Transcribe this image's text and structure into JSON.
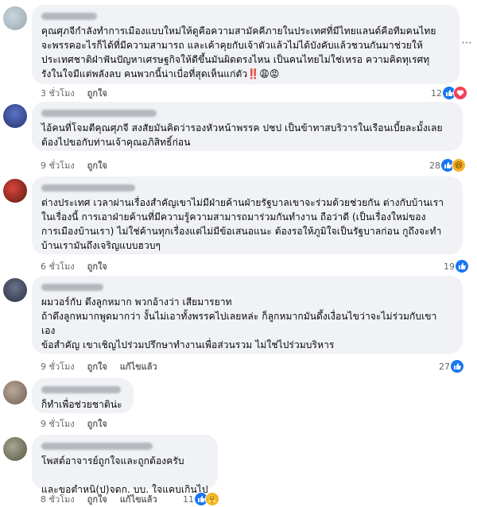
{
  "actions": {
    "like": "ถูกใจ",
    "reply": "",
    "edited": "แก้ไขแล้ว"
  },
  "comments": [
    {
      "text": "คุณศุภจีกำลังทำการเมืองแบบใหม่ให้ดูคือความสามัคคีภายในประเทศที่มีไทยแลนด์คือทีมคนไทย\nจะพรรคอะไรก็ได้ที่มีความสามารถ และเค้าคุยกับเจ้าตัวแล้วไม่ได้บังคับแล้วชวนกันมาช่วยให้\nประเทศชาติฝ่าฟันปัญหาเศรษฐกิจให้ดีขึ้นมันผิดตรงไหน เป็นคนไทยไม่ใช่เหรอ ความคิดทุเรศทุ\nรังในใจมีแต่พลังลบ คนพวกนี้น่าเบื่อที่สุดเห็นแก่ตัว‼️😩😡",
      "time": "3 ชั่วโมง",
      "reaction_count": "12",
      "reactions": [
        "like",
        "love"
      ]
    },
    {
      "text": "ไอ้คนที่โจมตีคุณศุภจี สงสัยมันคิดว่ารองหัวหน้าพรรค ปชป เป็นข้าทาสบริวารในเรือนเบี้ยละมั้งเลย\nต้องไปขอกับท่านเจ้าคุณอภิสิทธิ์ก่อน",
      "time": "9 ชั่วโมง",
      "reaction_count": "28",
      "reactions": [
        "like",
        "haha"
      ]
    },
    {
      "text": "ต่างประเทศ เวลาผ่านเรื่องสำคัญเขาไม่มีฝ่ายค้านฝ่ายรัฐบาลเขาจะร่วมด้วยช่วยกัน ต่างกับบ้านเรา\nในเรื่องนี้ การเอาฝ่ายค้านที่มีความรู้ความสามารถมาร่วมกันทำงาน ถือว่าดี (เป็นเรื่องใหม่ของ\nการเมืองบ้านเรา) ไม่ใช่ค้านทุกเรื่องแต่ไม่มีข้อเสนอแนะ ต้องรอให้ภูมิใจเป็นรัฐบาลก่อน กูถึงจะทำ\nบ้านเรามันถึงเจริญแบบฮวบๆ",
      "time": "6 ชั่วโมง",
      "reaction_count": "19",
      "reactions": [
        "like"
      ]
    },
    {
      "text": "ผมวอร์กับ ดึงลูกหมาก พวกอ้างว่า เสียมารยาท\nถ้าดึงลูกหมากพูดมากว่า งั้นไม่เอาทั้งพรรคไปเลยหล่ะ ก็ลูกหมากมันดึ้งเงื่อนไขว่าจะไม่ร่วมกับเขา\nเอง\nข้อสำคัญ เขาเชิญไปร่วมปรึกษาทำงานเพื่อส่วนรวม ไม่ใช่ไปร่วมบริหาร",
      "time": "9 ชั่วโมง",
      "edited": true,
      "reaction_count": "27",
      "reactions": [
        "like"
      ]
    },
    {
      "text": "ก็ทำเพื่อช่วยชาติน่ะ",
      "time": "9 ชั่วโมง",
      "reaction_count": "",
      "reactions": []
    },
    {
      "text": "โพสต์อาจารย์ถูกใจและถูกต้องครับ\n\nและขอตำหนิ(ป)จดก. บบ. ใจแคบเกินไป",
      "time": "8 ชั่วโมง",
      "edited": true,
      "reaction_count": "11",
      "reactions": [
        "like",
        "care"
      ]
    }
  ]
}
